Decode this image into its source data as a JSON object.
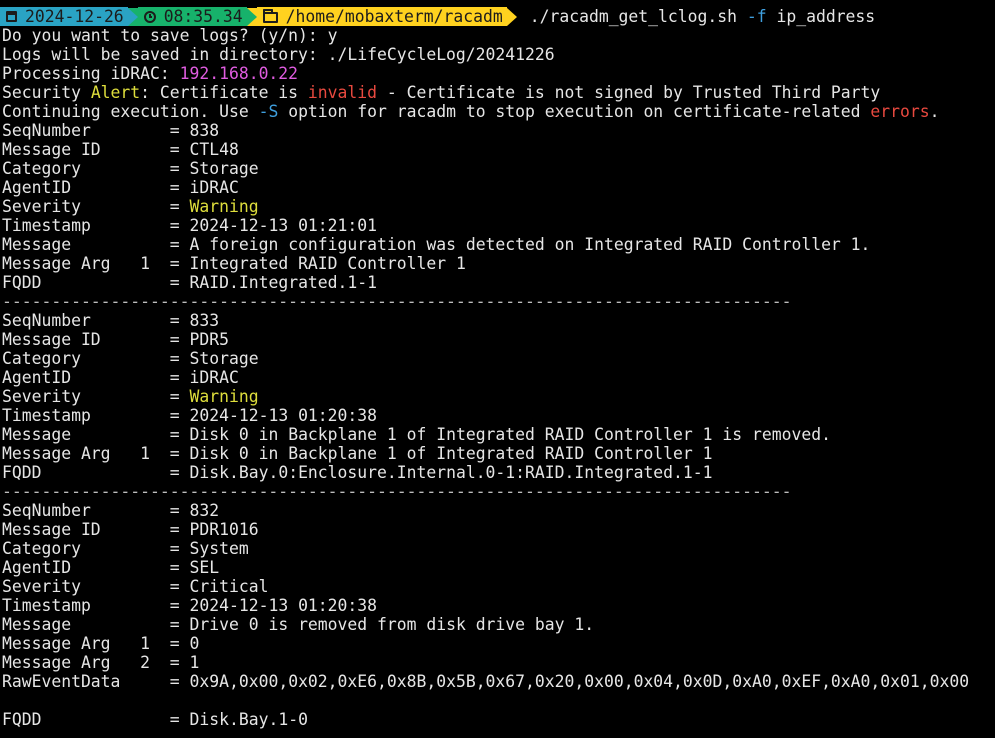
{
  "prompt": {
    "date": "2024-12-26",
    "time": "08:35.34",
    "path": "/home/mobaxterm/racadm",
    "command": "./racadm_get_lclog.sh",
    "flag": "-f",
    "argument": "ip_address",
    "colors": {
      "date_segment": "#2aa3c4",
      "time_segment": "#17b26b",
      "path_segment": "#ffd21f"
    },
    "icons": [
      "calendar-icon",
      "clock-icon",
      "folder-icon"
    ]
  },
  "output": {
    "save_question": "Do you want to save logs? (y/n): y",
    "save_dir": "Logs will be saved in directory: ./LifeCycleLog/20241226",
    "processing_label": "Processing iDRAC: ",
    "processing_ip": "192.168.0.22",
    "security": {
      "part1": "Security ",
      "alert": "Alert",
      "part2": ": Certificate is ",
      "invalid": "invalid",
      "part3": " - Certificate is not signed by Trusted Third Party"
    },
    "continuing": {
      "part1": "Continuing execution. Use ",
      "option": "-S",
      "part2": " option for racadm to stop execution on certificate-related ",
      "errors": "errors",
      "part3": "."
    },
    "separator": "--------------------------------------------------------------------------------"
  },
  "records": [
    {
      "fields": [
        {
          "key": "SeqNumber        ",
          "value": "838"
        },
        {
          "key": "Message ID       ",
          "value": "CTL48"
        },
        {
          "key": "Category         ",
          "value": "Storage"
        },
        {
          "key": "AgentID          ",
          "value": "iDRAC"
        },
        {
          "key": "Severity         ",
          "value": "Warning",
          "highlight": "yellow"
        },
        {
          "key": "Timestamp        ",
          "value": "2024-12-13 01:21:01"
        },
        {
          "key": "Message          ",
          "value": "A foreign configuration was detected on Integrated RAID Controller 1."
        },
        {
          "key": "Message Arg   1  ",
          "value": "Integrated RAID Controller 1"
        },
        {
          "key": "FQDD             ",
          "value": "RAID.Integrated.1-1"
        }
      ]
    },
    {
      "fields": [
        {
          "key": "SeqNumber        ",
          "value": "833"
        },
        {
          "key": "Message ID       ",
          "value": "PDR5"
        },
        {
          "key": "Category         ",
          "value": "Storage"
        },
        {
          "key": "AgentID          ",
          "value": "iDRAC"
        },
        {
          "key": "Severity         ",
          "value": "Warning",
          "highlight": "yellow"
        },
        {
          "key": "Timestamp        ",
          "value": "2024-12-13 01:20:38"
        },
        {
          "key": "Message          ",
          "value": "Disk 0 in Backplane 1 of Integrated RAID Controller 1 is removed."
        },
        {
          "key": "Message Arg   1  ",
          "value": "Disk 0 in Backplane 1 of Integrated RAID Controller 1"
        },
        {
          "key": "FQDD             ",
          "value": "Disk.Bay.0:Enclosure.Internal.0-1:RAID.Integrated.1-1"
        }
      ]
    },
    {
      "fields": [
        {
          "key": "SeqNumber        ",
          "value": "832"
        },
        {
          "key": "Message ID       ",
          "value": "PDR1016"
        },
        {
          "key": "Category         ",
          "value": "System"
        },
        {
          "key": "AgentID          ",
          "value": "SEL"
        },
        {
          "key": "Severity         ",
          "value": "Critical"
        },
        {
          "key": "Timestamp        ",
          "value": "2024-12-13 01:20:38"
        },
        {
          "key": "Message          ",
          "value": "Drive 0 is removed from disk drive bay 1."
        },
        {
          "key": "Message Arg   1  ",
          "value": "0"
        },
        {
          "key": "Message Arg   2  ",
          "value": "1"
        },
        {
          "key": "RawEventData     ",
          "value": "0x9A,0x00,0x02,0xE6,0x8B,0x5B,0x67,0x20,0x00,0x04,0x0D,0xA0,0xEF,0xA0,0x01,0x00"
        },
        {
          "blank": true
        },
        {
          "key": "FQDD             ",
          "value": "Disk.Bay.1-0"
        }
      ]
    }
  ]
}
